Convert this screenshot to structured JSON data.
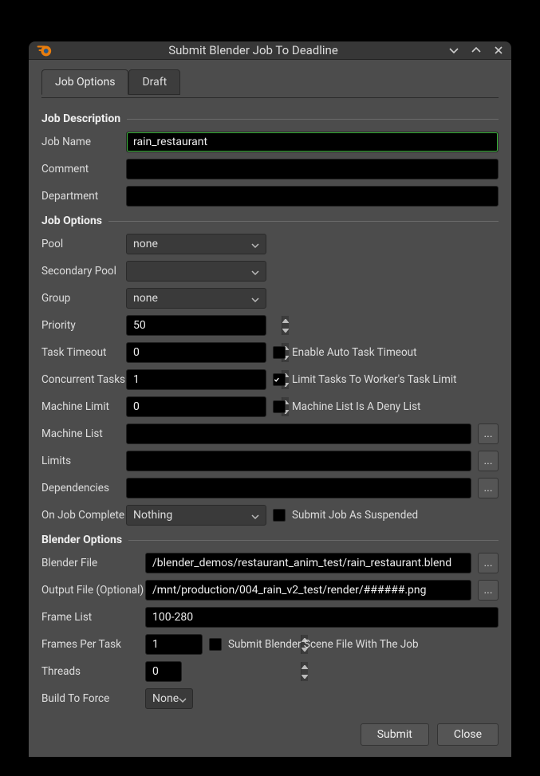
{
  "title": "Submit Blender Job To Deadline",
  "tabs": {
    "job_options": "Job Options",
    "draft": "Draft"
  },
  "sections": {
    "job_description": "Job Description",
    "job_options": "Job Options",
    "blender_options": "Blender Options"
  },
  "labels": {
    "job_name": "Job Name",
    "comment": "Comment",
    "department": "Department",
    "pool": "Pool",
    "secondary_pool": "Secondary Pool",
    "group": "Group",
    "priority": "Priority",
    "task_timeout": "Task Timeout",
    "concurrent_tasks": "Concurrent Tasks",
    "machine_limit": "Machine Limit",
    "machine_list": "Machine List",
    "limits": "Limits",
    "dependencies": "Dependencies",
    "on_job_complete": "On Job Complete",
    "blender_file": "Blender File",
    "output_file": "Output File (Optional)",
    "frame_list": "Frame List",
    "frames_per_task": "Frames Per Task",
    "threads": "Threads",
    "build_to_force": "Build To Force"
  },
  "values": {
    "job_name": "rain_restaurant",
    "comment": "",
    "department": "",
    "pool": "none",
    "secondary_pool": "",
    "group": "none",
    "priority": "50",
    "task_timeout": "0",
    "concurrent_tasks": "1",
    "machine_limit": "0",
    "machine_list": "",
    "limits": "",
    "dependencies": "",
    "on_job_complete": "Nothing",
    "blender_file": "/blender_demos/restaurant_anim_test/rain_restaurant.blend",
    "output_file": "/mnt/production/004_rain_v2_test/render/######.png",
    "frame_list": "100-280",
    "frames_per_task": "1",
    "threads": "0",
    "build_to_force": "None"
  },
  "checkboxes": {
    "enable_auto_task_timeout": {
      "label": "Enable Auto Task Timeout",
      "checked": false
    },
    "limit_tasks_worker": {
      "label": "Limit Tasks To Worker's Task Limit",
      "checked": true
    },
    "machine_list_deny": {
      "label": "Machine List Is A Deny List",
      "checked": false
    },
    "submit_suspended": {
      "label": "Submit Job As Suspended",
      "checked": false
    },
    "submit_scene_with_job": {
      "label": "Submit Blender Scene File With The Job",
      "checked": false
    }
  },
  "buttons": {
    "submit": "Submit",
    "close": "Close",
    "browse": "..."
  }
}
